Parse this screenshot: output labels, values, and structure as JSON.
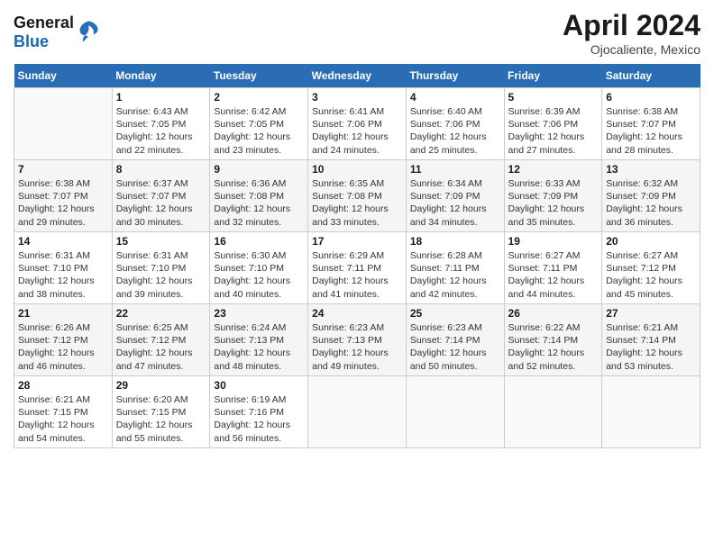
{
  "header": {
    "logo_general": "General",
    "logo_blue": "Blue",
    "month": "April 2024",
    "location": "Ojocaliente, Mexico"
  },
  "days_of_week": [
    "Sunday",
    "Monday",
    "Tuesday",
    "Wednesday",
    "Thursday",
    "Friday",
    "Saturday"
  ],
  "weeks": [
    [
      {
        "day": "",
        "info": ""
      },
      {
        "day": "1",
        "info": "Sunrise: 6:43 AM\nSunset: 7:05 PM\nDaylight: 12 hours\nand 22 minutes."
      },
      {
        "day": "2",
        "info": "Sunrise: 6:42 AM\nSunset: 7:05 PM\nDaylight: 12 hours\nand 23 minutes."
      },
      {
        "day": "3",
        "info": "Sunrise: 6:41 AM\nSunset: 7:06 PM\nDaylight: 12 hours\nand 24 minutes."
      },
      {
        "day": "4",
        "info": "Sunrise: 6:40 AM\nSunset: 7:06 PM\nDaylight: 12 hours\nand 25 minutes."
      },
      {
        "day": "5",
        "info": "Sunrise: 6:39 AM\nSunset: 7:06 PM\nDaylight: 12 hours\nand 27 minutes."
      },
      {
        "day": "6",
        "info": "Sunrise: 6:38 AM\nSunset: 7:07 PM\nDaylight: 12 hours\nand 28 minutes."
      }
    ],
    [
      {
        "day": "7",
        "info": "Sunrise: 6:38 AM\nSunset: 7:07 PM\nDaylight: 12 hours\nand 29 minutes."
      },
      {
        "day": "8",
        "info": "Sunrise: 6:37 AM\nSunset: 7:07 PM\nDaylight: 12 hours\nand 30 minutes."
      },
      {
        "day": "9",
        "info": "Sunrise: 6:36 AM\nSunset: 7:08 PM\nDaylight: 12 hours\nand 32 minutes."
      },
      {
        "day": "10",
        "info": "Sunrise: 6:35 AM\nSunset: 7:08 PM\nDaylight: 12 hours\nand 33 minutes."
      },
      {
        "day": "11",
        "info": "Sunrise: 6:34 AM\nSunset: 7:09 PM\nDaylight: 12 hours\nand 34 minutes."
      },
      {
        "day": "12",
        "info": "Sunrise: 6:33 AM\nSunset: 7:09 PM\nDaylight: 12 hours\nand 35 minutes."
      },
      {
        "day": "13",
        "info": "Sunrise: 6:32 AM\nSunset: 7:09 PM\nDaylight: 12 hours\nand 36 minutes."
      }
    ],
    [
      {
        "day": "14",
        "info": "Sunrise: 6:31 AM\nSunset: 7:10 PM\nDaylight: 12 hours\nand 38 minutes."
      },
      {
        "day": "15",
        "info": "Sunrise: 6:31 AM\nSunset: 7:10 PM\nDaylight: 12 hours\nand 39 minutes."
      },
      {
        "day": "16",
        "info": "Sunrise: 6:30 AM\nSunset: 7:10 PM\nDaylight: 12 hours\nand 40 minutes."
      },
      {
        "day": "17",
        "info": "Sunrise: 6:29 AM\nSunset: 7:11 PM\nDaylight: 12 hours\nand 41 minutes."
      },
      {
        "day": "18",
        "info": "Sunrise: 6:28 AM\nSunset: 7:11 PM\nDaylight: 12 hours\nand 42 minutes."
      },
      {
        "day": "19",
        "info": "Sunrise: 6:27 AM\nSunset: 7:11 PM\nDaylight: 12 hours\nand 44 minutes."
      },
      {
        "day": "20",
        "info": "Sunrise: 6:27 AM\nSunset: 7:12 PM\nDaylight: 12 hours\nand 45 minutes."
      }
    ],
    [
      {
        "day": "21",
        "info": "Sunrise: 6:26 AM\nSunset: 7:12 PM\nDaylight: 12 hours\nand 46 minutes."
      },
      {
        "day": "22",
        "info": "Sunrise: 6:25 AM\nSunset: 7:12 PM\nDaylight: 12 hours\nand 47 minutes."
      },
      {
        "day": "23",
        "info": "Sunrise: 6:24 AM\nSunset: 7:13 PM\nDaylight: 12 hours\nand 48 minutes."
      },
      {
        "day": "24",
        "info": "Sunrise: 6:23 AM\nSunset: 7:13 PM\nDaylight: 12 hours\nand 49 minutes."
      },
      {
        "day": "25",
        "info": "Sunrise: 6:23 AM\nSunset: 7:14 PM\nDaylight: 12 hours\nand 50 minutes."
      },
      {
        "day": "26",
        "info": "Sunrise: 6:22 AM\nSunset: 7:14 PM\nDaylight: 12 hours\nand 52 minutes."
      },
      {
        "day": "27",
        "info": "Sunrise: 6:21 AM\nSunset: 7:14 PM\nDaylight: 12 hours\nand 53 minutes."
      }
    ],
    [
      {
        "day": "28",
        "info": "Sunrise: 6:21 AM\nSunset: 7:15 PM\nDaylight: 12 hours\nand 54 minutes."
      },
      {
        "day": "29",
        "info": "Sunrise: 6:20 AM\nSunset: 7:15 PM\nDaylight: 12 hours\nand 55 minutes."
      },
      {
        "day": "30",
        "info": "Sunrise: 6:19 AM\nSunset: 7:16 PM\nDaylight: 12 hours\nand 56 minutes."
      },
      {
        "day": "",
        "info": ""
      },
      {
        "day": "",
        "info": ""
      },
      {
        "day": "",
        "info": ""
      },
      {
        "day": "",
        "info": ""
      }
    ]
  ]
}
